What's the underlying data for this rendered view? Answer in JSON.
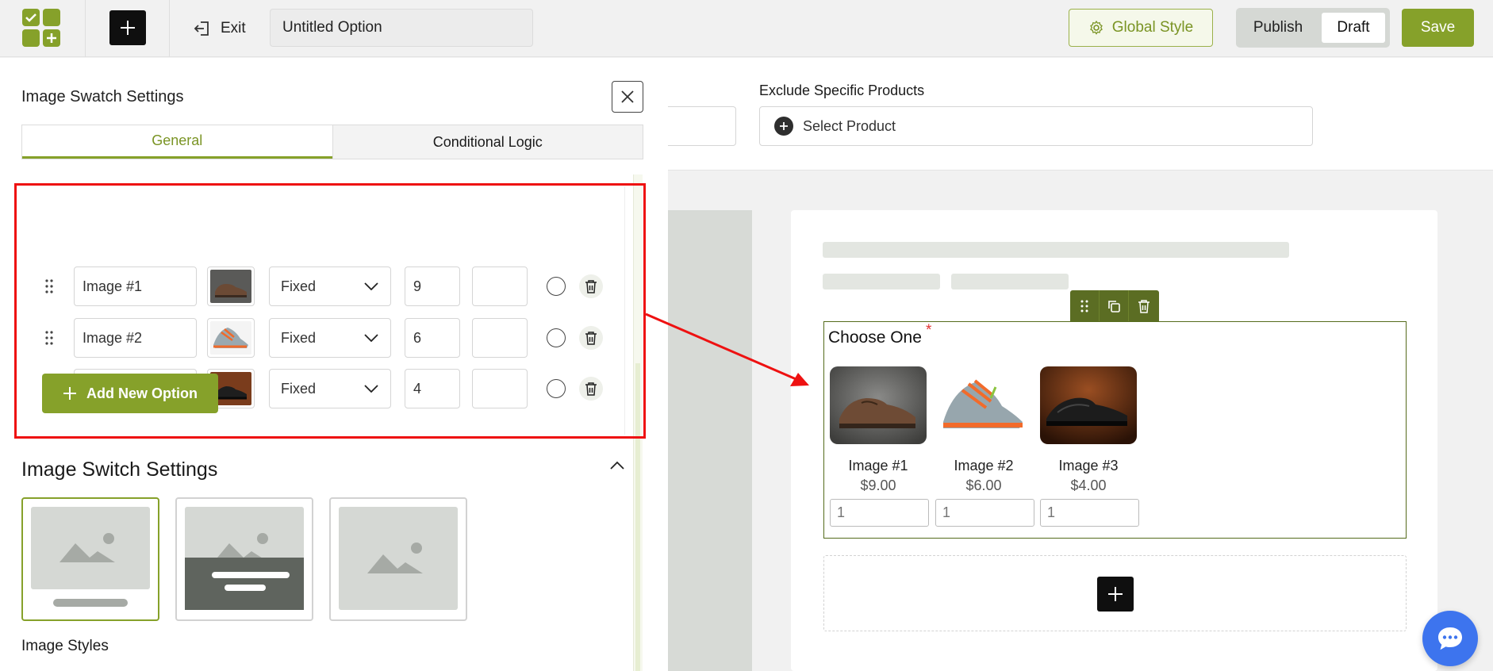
{
  "header": {
    "exit_label": "Exit",
    "title_value": "Untitled Option",
    "global_style_label": "Global Style",
    "publish_label": "Publish",
    "draft_label": "Draft",
    "save_label": "Save"
  },
  "panel": {
    "title": "Image Swatch Settings",
    "tabs": [
      {
        "label": "General",
        "active": true
      },
      {
        "label": "Conditional Logic",
        "active": false
      }
    ],
    "options": [
      {
        "name": "Image #1",
        "price_type": "Fixed",
        "price": "9",
        "extra": ""
      },
      {
        "name": "Image #2",
        "price_type": "Fixed",
        "price": "6",
        "extra": ""
      },
      {
        "name": "Image #3",
        "price_type": "Fixed",
        "price": "4",
        "extra": ""
      }
    ],
    "add_option_label": "Add New Option",
    "switch_settings_title": "Image Switch Settings",
    "image_styles_label": "Image Styles"
  },
  "builder": {
    "exclude_label": "Exclude Specific Products",
    "select_product_label": "Select Product",
    "field_label": "Choose One",
    "required_mark": "*",
    "swatches": [
      {
        "name": "Image #1",
        "price": "$9.00",
        "qty_placeholder": "1"
      },
      {
        "name": "Image #2",
        "price": "$6.00",
        "qty_placeholder": "1"
      },
      {
        "name": "Image #3",
        "price": "$4.00",
        "qty_placeholder": "1"
      }
    ]
  },
  "colors": {
    "accent": "#86a12a",
    "annotation": "#ee1111",
    "chat": "#3d74ee"
  }
}
